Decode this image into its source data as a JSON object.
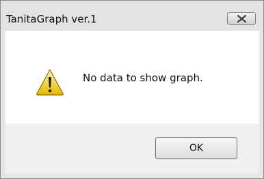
{
  "window": {
    "title": "TanitaGraph ver.1",
    "close_icon": "close-icon"
  },
  "dialog": {
    "icon": "warning-icon",
    "message": "No data to show graph."
  },
  "buttons": {
    "ok_label": "OK"
  },
  "colors": {
    "titlebar_bg": "#e3e3e3",
    "content_bg": "#ffffff",
    "footer_bg": "#f0f0f0",
    "warning_yellow": "#f2c400"
  }
}
